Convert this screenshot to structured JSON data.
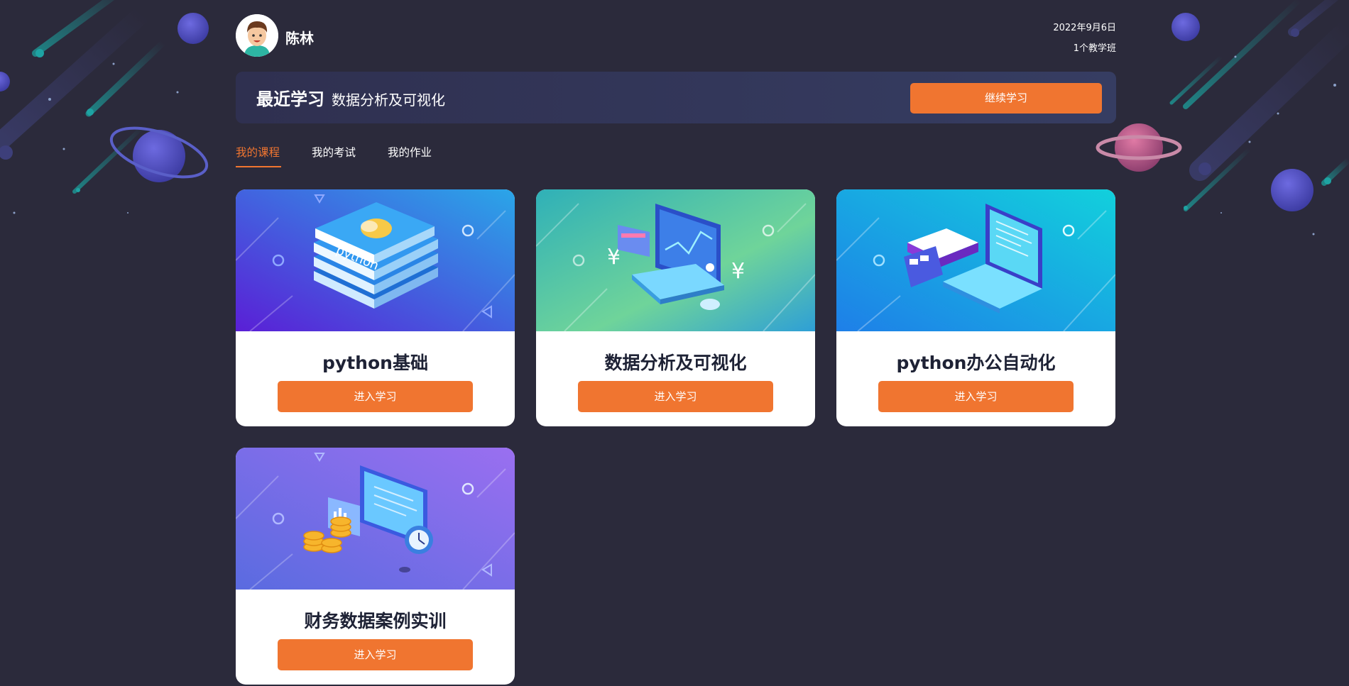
{
  "user": {
    "name": "陈林",
    "avatar_icon": "boy-avatar-icon"
  },
  "meta": {
    "date": "2022年9月6日",
    "class_count": "1个教学班"
  },
  "recent": {
    "title": "最近学习",
    "course": "数据分析及可视化",
    "button": "继续学习"
  },
  "tabs": [
    {
      "label": "我的课程",
      "active": true
    },
    {
      "label": "我的考试",
      "active": false
    },
    {
      "label": "我的作业",
      "active": false
    }
  ],
  "courses": [
    {
      "title": "python基础",
      "button": "进入学习",
      "illustration": "python-books-icon"
    },
    {
      "title": "数据分析及可视化",
      "button": "进入学习",
      "illustration": "data-dashboard-icon"
    },
    {
      "title": "python办公自动化",
      "button": "进入学习",
      "illustration": "laptop-office-icon"
    },
    {
      "title": "财务数据案例实训",
      "button": "进入学习",
      "illustration": "finance-coins-icon"
    }
  ],
  "colors": {
    "background": "#2b2a3b",
    "accent": "#f07530",
    "card_title": "#1e2235"
  }
}
